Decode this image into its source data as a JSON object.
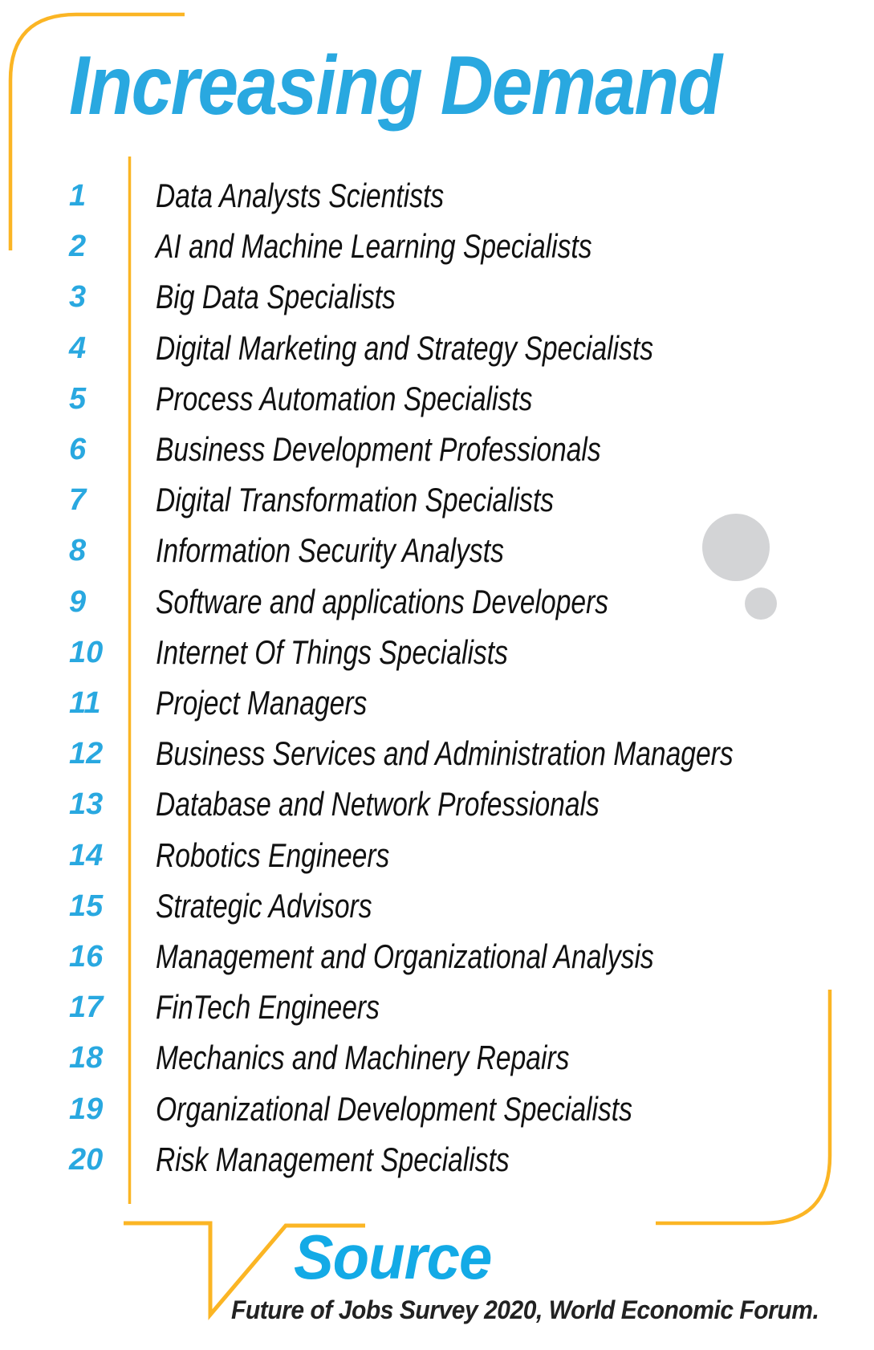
{
  "title": "Increasing Demand",
  "colors": {
    "accent_blue": "#29a8e0",
    "bracket_yellow": "#fbb524",
    "bubble_gray": "#d3d4d6",
    "text": "#111111"
  },
  "list": {
    "items": [
      {
        "rank": "1",
        "label": "Data Analysts Scientists"
      },
      {
        "rank": "2",
        "label": "AI and Machine Learning Specialists"
      },
      {
        "rank": "3",
        "label": "Big Data Specialists"
      },
      {
        "rank": "4",
        "label": "Digital Marketing and Strategy Specialists"
      },
      {
        "rank": "5",
        "label": "Process Automation Specialists"
      },
      {
        "rank": "6",
        "label": "Business Development Professionals"
      },
      {
        "rank": "7",
        "label": "Digital Transformation Specialists"
      },
      {
        "rank": "8",
        "label": "Information Security Analysts"
      },
      {
        "rank": "9",
        "label": "Software and applications Developers"
      },
      {
        "rank": "10",
        "label": "Internet Of Things Specialists"
      },
      {
        "rank": "11",
        "label": "Project Managers"
      },
      {
        "rank": "12",
        "label": "Business Services and Administration Managers"
      },
      {
        "rank": "13",
        "label": "Database and Network Professionals"
      },
      {
        "rank": "14",
        "label": "Robotics Engineers"
      },
      {
        "rank": "15",
        "label": "Strategic Advisors"
      },
      {
        "rank": "16",
        "label": "Management and Organizational Analysis"
      },
      {
        "rank": "17",
        "label": "FinTech Engineers"
      },
      {
        "rank": "18",
        "label": "Mechanics and Machinery Repairs"
      },
      {
        "rank": "19",
        "label": "Organizational Development Specialists"
      },
      {
        "rank": "20",
        "label": "Risk Management Specialists"
      }
    ]
  },
  "source": {
    "heading": "Source",
    "citation": "Future of Jobs Survey 2020, World Economic Forum."
  },
  "decorations": {
    "bubbles_icon": "thought-bubbles-icon"
  }
}
